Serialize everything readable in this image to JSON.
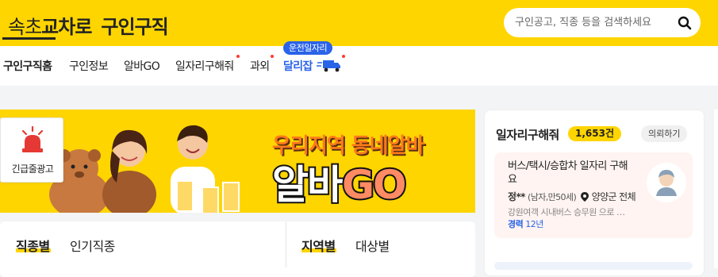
{
  "header": {
    "logo_prefix": "속초",
    "logo_brand": "교차로",
    "logo_suffix": "구인구직",
    "search_placeholder": "구인공고, 직종 등을 검색하세요"
  },
  "nav": {
    "items": [
      {
        "label": "구인구직홈",
        "active": true
      },
      {
        "label": "구인정보"
      },
      {
        "label": "알바GO"
      },
      {
        "label": "일자리구해줘"
      },
      {
        "label": "과외"
      },
      {
        "label": "달리잡"
      }
    ],
    "badge": "운전일자리"
  },
  "banner": {
    "line1": "우리지역 동네알바",
    "line2_a": "알바",
    "line2_b": "GO"
  },
  "ad": {
    "label": "긴급줄광고"
  },
  "categories": {
    "tabs_left": [
      "직종별",
      "인기직종"
    ],
    "tabs_right": [
      "지역별",
      "대상별"
    ]
  },
  "job_panel": {
    "title": "일자리구해줘",
    "count": "1,653건",
    "request": "의뢰하기",
    "card": {
      "title": "버스/택시/승합차 일자리 구해요",
      "name": "정**",
      "info": "(남자,만50세)",
      "location": "양양군 전체",
      "desc": "강원여객 시내버스 승무원 으로 …",
      "exp_label": "경력",
      "exp_value": "12년"
    }
  }
}
